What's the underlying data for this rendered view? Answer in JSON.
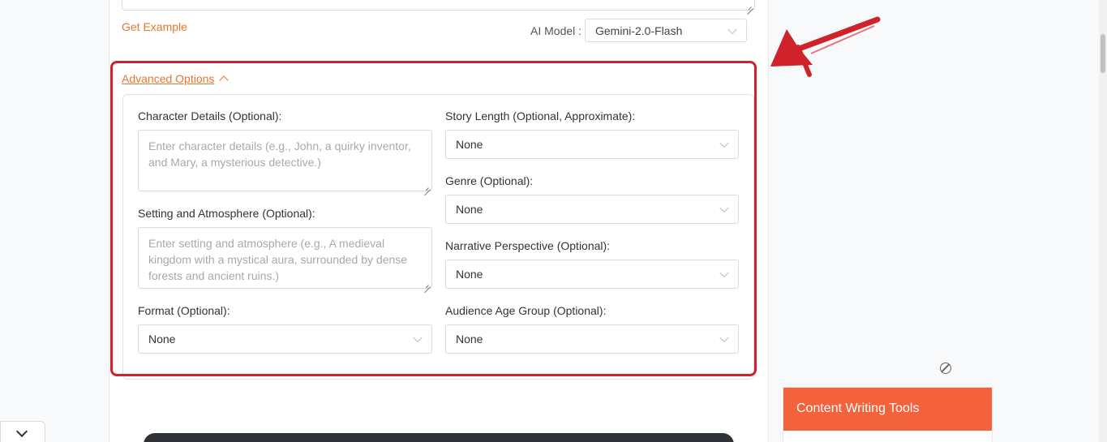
{
  "header": {
    "get_example": "Get Example",
    "ai_model_label": "AI Model :",
    "ai_model_value": "Gemini-2.0-Flash"
  },
  "advanced": {
    "toggle_label": "Advanced Options",
    "character": {
      "label": "Character Details (Optional):",
      "placeholder": "Enter character details (e.g., John, a quirky inventor, and Mary, a mysterious detective.)"
    },
    "setting": {
      "label": "Setting and Atmosphere (Optional):",
      "placeholder": "Enter setting and atmosphere (e.g., A medieval kingdom with a mystical aura, surrounded by dense forests and ancient ruins.)"
    },
    "format": {
      "label": "Format (Optional):",
      "value": "None"
    },
    "story_length": {
      "label": "Story Length (Optional, Approximate):",
      "value": "None"
    },
    "genre": {
      "label": "Genre (Optional):",
      "value": "None"
    },
    "perspective": {
      "label": "Narrative Perspective (Optional):",
      "value": "None"
    },
    "audience": {
      "label": "Audience Age Group (Optional):",
      "value": "None"
    }
  },
  "sidebar": {
    "tools_title": "Content Writing Tools"
  },
  "colors": {
    "accent": "#e8762d",
    "highlight": "#d0222a",
    "tools_header": "#f2633d"
  }
}
